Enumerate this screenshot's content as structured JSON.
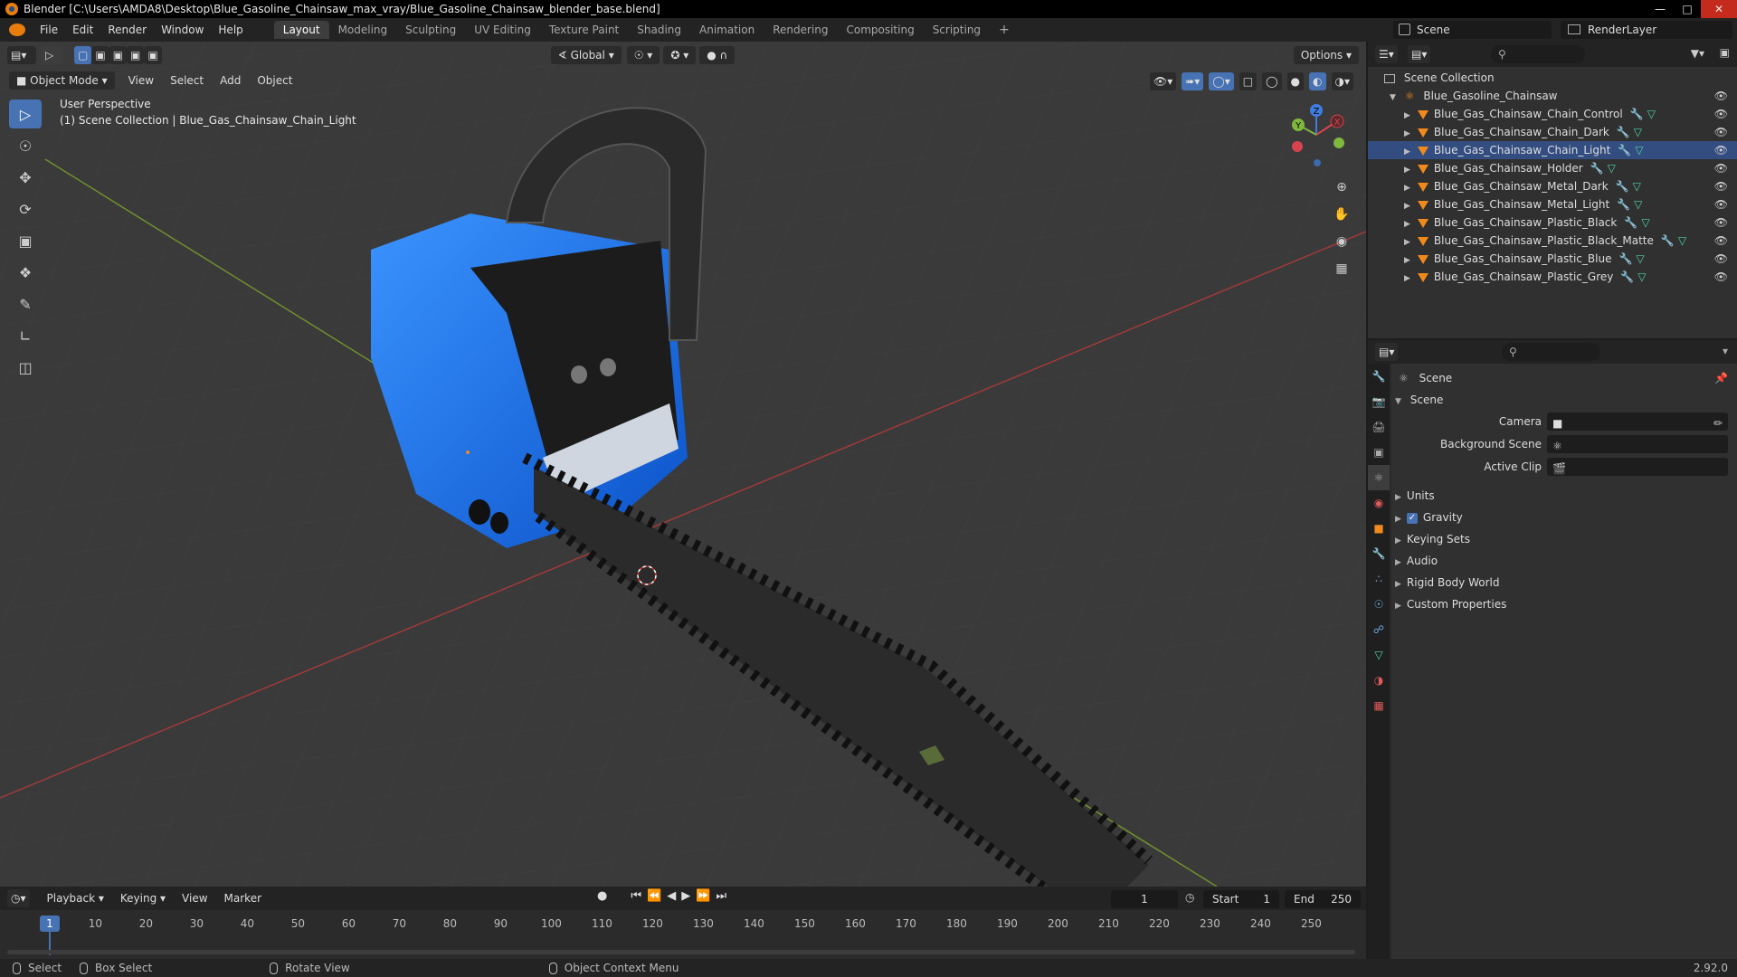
{
  "window": {
    "title": "Blender [C:\\Users\\AMDA8\\Desktop\\Blue_Gasoline_Chainsaw_max_vray/Blue_Gasoline_Chainsaw_blender_base.blend]",
    "minimize": "—",
    "maximize": "□",
    "close": "✕"
  },
  "menu": {
    "items": [
      "File",
      "Edit",
      "Render",
      "Window",
      "Help"
    ]
  },
  "workspaces": {
    "tabs": [
      "Layout",
      "Modeling",
      "Sculpting",
      "UV Editing",
      "Texture Paint",
      "Shading",
      "Animation",
      "Rendering",
      "Compositing",
      "Scripting"
    ],
    "active": "Layout",
    "add": "+"
  },
  "scene_selector": {
    "value": "Scene"
  },
  "view_layer_selector": {
    "value": "RenderLayer"
  },
  "viewport": {
    "mode": "Object Mode",
    "menus": [
      "View",
      "Select",
      "Add",
      "Object"
    ],
    "orientation": "Global",
    "options_label": "Options",
    "perspective": "User Perspective",
    "collection_info": "(1) Scene Collection | Blue_Gas_Chainsaw_Chain_Light",
    "gizmo": {
      "x": "X",
      "y": "Y",
      "z": "Z"
    }
  },
  "outliner": {
    "root": "Scene Collection",
    "collection": "Blue_Gasoline_Chainsaw",
    "objects": [
      "Blue_Gas_Chainsaw_Chain_Control",
      "Blue_Gas_Chainsaw_Chain_Dark",
      "Blue_Gas_Chainsaw_Chain_Light",
      "Blue_Gas_Chainsaw_Holder",
      "Blue_Gas_Chainsaw_Metal_Dark",
      "Blue_Gas_Chainsaw_Metal_Light",
      "Blue_Gas_Chainsaw_Plastic_Black",
      "Blue_Gas_Chainsaw_Plastic_Black_Matte",
      "Blue_Gas_Chainsaw_Plastic_Blue",
      "Blue_Gas_Chainsaw_Plastic_Grey"
    ],
    "active_object": "Blue_Gas_Chainsaw_Chain_Light"
  },
  "properties": {
    "context": "Scene",
    "panel": "Scene",
    "fields": {
      "camera": "Camera",
      "background_scene": "Background Scene",
      "active_clip": "Active Clip"
    },
    "subpanels": [
      "Units",
      "Gravity",
      "Keying Sets",
      "Audio",
      "Rigid Body World",
      "Custom Properties"
    ],
    "gravity_enabled": true
  },
  "timeline": {
    "menus": [
      "Playback",
      "Keying",
      "View",
      "Marker"
    ],
    "current_frame": "1",
    "start_label": "Start",
    "start_value": "1",
    "end_label": "End",
    "end_value": "250",
    "ruler": [
      "1",
      "10",
      "20",
      "30",
      "40",
      "50",
      "60",
      "70",
      "80",
      "90",
      "100",
      "110",
      "120",
      "130",
      "140",
      "150",
      "160",
      "170",
      "180",
      "190",
      "200",
      "210",
      "220",
      "230",
      "240",
      "250"
    ]
  },
  "statusbar": {
    "select": "Select",
    "box_select": "Box Select",
    "rotate_view": "Rotate View",
    "context_menu": "Object Context Menu",
    "version": "2.92.0"
  },
  "colors": {
    "accent": "#4772b3",
    "object_orange": "#f08a1d",
    "axis_x": "#c0392b",
    "axis_y": "#6f9a2e",
    "chainsaw_blue": "#1e7bff"
  }
}
